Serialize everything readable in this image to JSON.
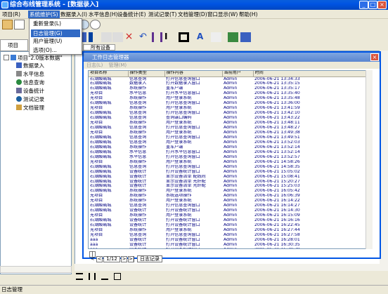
{
  "window": {
    "title": "综合布线管理系统 - [数据录入]"
  },
  "menubar": [
    "项目(R)",
    "系统维护(S)",
    "数据录入(I)",
    "水平信息(H)",
    "设备统计(E)",
    "测试记录(T)",
    "文档管理(D)",
    "窗口显示(W)",
    "帮助(H)"
  ],
  "dropdown": [
    "重新登录(L)",
    "日志管理(G)",
    "用户管理(U)",
    "选项(O)..."
  ],
  "left_panel": {
    "tab": "项目",
    "root": "项目\"2.0版本数据\"",
    "items": [
      "数据录入",
      "水平信息",
      "信息查询",
      "设备统计",
      "测试记录",
      "文档管理"
    ]
  },
  "doc": {
    "tab": "所有设备"
  },
  "dialog": {
    "title": "工作日志管理器",
    "menu": [
      "日志(L)",
      "管理(M)"
    ],
    "columns": [
      "项目名称",
      "操作类型",
      "操作内容",
      "当前用户",
      "时间"
    ],
    "rows": [
      [
        "石湖酸碱城",
        "信息查询",
        "打开信息查询窗口",
        "Admin",
        "2006-06-21 13:34:33"
      ],
      [
        "石湖酸碱城",
        "数据录入",
        "打开数据录入窗口",
        "Admin",
        "2006-06-21 13:35:15"
      ],
      [
        "石湖酸碱城",
        "系统操作",
        "重车户端",
        "Admin",
        "2006-06-21 13:35:17"
      ],
      [
        "无项目",
        "水平信息",
        "打开水平信息窗口",
        "Admin",
        "2006-06-21 13:35:40"
      ],
      [
        "无项目",
        "系统操作",
        "用户登录系统",
        "Admin",
        "2006-06-21 13:35:48"
      ],
      [
        "石湖酸碱城",
        "信息查询",
        "打开信息查询窗口",
        "Admin",
        "2006-06-21 13:36:00"
      ],
      [
        "无项目",
        "系统操作",
        "用户登录系统",
        "Admin",
        "2006-06-21 13:41:59"
      ],
      [
        "石湖酸碱城",
        "信息查询",
        "打开信息查询窗口",
        "Admin",
        "2006-06-21 13:42:10"
      ],
      [
        "石湖酸碱城",
        "信息查询",
        "查询端口编码",
        "Admin",
        "2006-06-21 13:43:22"
      ],
      [
        "无项目",
        "系统操作",
        "用户登录系统",
        "Admin",
        "2006-06-21 13:48:11"
      ],
      [
        "石湖酸碱城",
        "信息查询",
        "打开信息查询窗口",
        "Admin",
        "2006-06-21 13:48:27"
      ],
      [
        "无项目",
        "系统操作",
        "用户登录系统",
        "Admin",
        "2006-06-21 13:49:38"
      ],
      [
        "石湖酸碱城",
        "信息查询",
        "打开信息查询窗口",
        "Admin",
        "2006-06-21 13:49:51"
      ],
      [
        "石湖酸碱城",
        "信息查询",
        "用户登录系统",
        "Admin",
        "2006-06-21 13:52:03"
      ],
      [
        "石湖酸碱城",
        "系统操作",
        "重车户端",
        "Admin",
        "2006-06-21 13:52:14"
      ],
      [
        "石湖酸碱城",
        "水平信息",
        "打开水平信息窗口",
        "Admin",
        "2006-06-21 13:52:14"
      ],
      [
        "石湖酸碱城",
        "水平信息",
        "打开信息查询窗口",
        "Admin",
        "2006-06-21 13:52:57"
      ],
      [
        "无项目",
        "系统操作",
        "用户登录系统",
        "Admin",
        "2006-06-21 14:58:26"
      ],
      [
        "石湖酸碱城",
        "信息查询",
        "打开信息查询窗口",
        "Admin",
        "2006-06-21 14:58:35"
      ],
      [
        "石湖酸碱城",
        "设备统计",
        "打开设备统计窗口",
        "Admin",
        "2006-06-21 15:05:02"
      ],
      [
        "石湖酸碱城",
        "设备统计",
        "显示设备清单 配线间",
        "Admin",
        "2006-06-21 15:08:41"
      ],
      [
        "石湖酸碱城",
        "设备统计",
        "显示设备清单 光纤配",
        "Admin",
        "2006-06-21 15:20:27"
      ],
      [
        "石湖酸碱城",
        "设备统计",
        "显示设备清单 光纤配",
        "Admin",
        "2006-06-21 15:25:03"
      ],
      [
        "石湖酸碱城",
        "系统操作",
        "用户登录系统",
        "Admin",
        "2006-06-21 16:05:42"
      ],
      [
        "无项目",
        "系统操作",
        "系统选项操作",
        "Admin",
        "2006-06-21 16:06:39"
      ],
      [
        "无项目",
        "系统操作",
        "用户登录系统",
        "Admin",
        "2006-06-21 16:14:22"
      ],
      [
        "石湖酸碱城",
        "信息查询",
        "打开信息查询窗口",
        "Admin",
        "2006-06-21 16:14:27"
      ],
      [
        "石湖酸碱城",
        "设备统计",
        "打开设备统计窗口",
        "Admin",
        "2006-06-21 16:14:30"
      ],
      [
        "无项目",
        "系统操作",
        "用户登录系统",
        "Admin",
        "2006-06-21 16:15:09"
      ],
      [
        "石湖酸碱城",
        "设备统计",
        "打开设备统计窗口",
        "Admin",
        "2006-06-21 16:16:16"
      ],
      [
        "石湖酸碱城",
        "设备统计",
        "打开设备统计窗口",
        "Admin",
        "2006-06-21 16:22:45"
      ],
      [
        "无项目",
        "系统操作",
        "用户登录系统",
        "Admin",
        "2006-06-21 16:27:44"
      ],
      [
        "无项目",
        "信息查询",
        "打开信息查询窗口",
        "Admin",
        "2006-06-21 16:27:58"
      ],
      [
        "aaa",
        "设备统计",
        "打开设备统计窗口",
        "Admin",
        "2006-06-21 16:28:01"
      ],
      [
        "aaa",
        "设备统计",
        "打开设备统计窗口",
        "Admin",
        "2006-06-21 16:30:35"
      ],
      [
        "aaa",
        "设备统计",
        "打开设备统计窗口",
        "Admin",
        "2006-06-21 16:30:39"
      ]
    ],
    "pager": {
      "first": "|<",
      "prev": "<",
      "page": "1/12",
      "next": ">",
      "last": ">|",
      "tab": "日志记录"
    }
  },
  "status": {
    "text": "日志管理"
  }
}
